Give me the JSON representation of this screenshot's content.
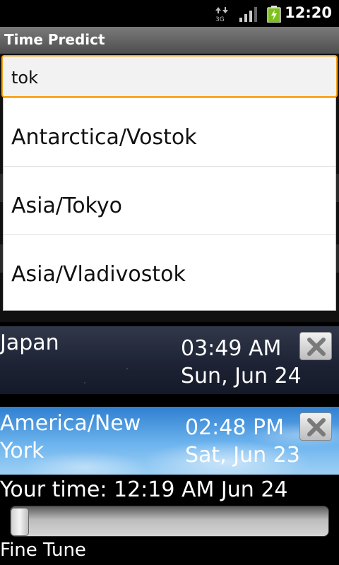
{
  "status_bar": {
    "network_type": "3G",
    "time": "12:20",
    "icons": [
      "data-arrows-icon",
      "signal-icon",
      "battery-charging-icon"
    ]
  },
  "app": {
    "title": "Time Predict"
  },
  "search": {
    "value": "tok"
  },
  "dropdown": {
    "items": [
      {
        "label": "Antarctica/Vostok"
      },
      {
        "label": "Asia/Tokyo"
      },
      {
        "label": "Asia/Vladivostok"
      }
    ]
  },
  "cities": [
    {
      "name": "Japan",
      "time": "03:49 AM",
      "date": "Sun, Jun 24",
      "background": "night"
    },
    {
      "name": "America/New York",
      "time": "02:48 PM",
      "date": "Sat, Jun 23",
      "background": "day"
    }
  ],
  "your_time": {
    "text": "Your time: 12:19 AM Jun 24"
  },
  "slider": {
    "label": "Fine Tune",
    "value_fraction": 0.0
  },
  "colors": {
    "accent": "#f7a21b",
    "day_sky": "#6db4ee",
    "night_sky": "#1c2233"
  }
}
